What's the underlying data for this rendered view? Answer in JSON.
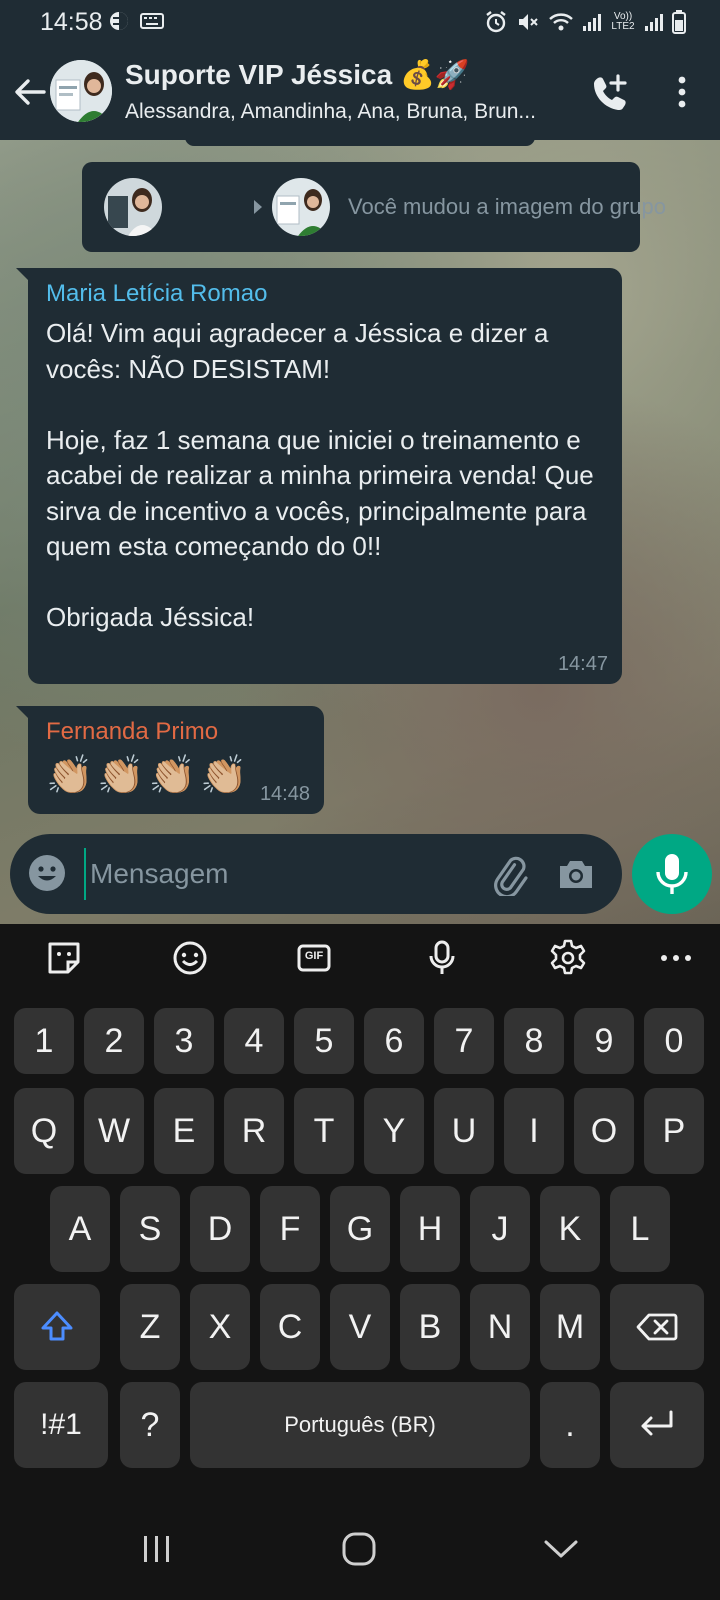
{
  "status_bar": {
    "time": "14:58",
    "left_icons": [
      "mode-icon",
      "keyboard-icon"
    ],
    "right_icons": [
      "alarm-icon",
      "mute-icon",
      "wifi-icon",
      "signal-icon",
      "volte-icon",
      "signal-icon",
      "battery-icon"
    ],
    "volte_label": "Vo)) LTE2"
  },
  "header": {
    "title": "Suporte VIP Jéssica 💰🚀",
    "subtitle": "Alessandra, Amandinha, Ana, Bruna, Brun..."
  },
  "chat": {
    "system_message": "Você mudou a imagem do grupo",
    "messages": [
      {
        "sender": "Maria Letícia Romao",
        "sender_color": "#53bdeb",
        "text": "Olá! Vim aqui agradecer a Jéssica e dizer a vocês: NÃO DESISTAM!\n\nHoje, faz 1 semana que iniciei o treinamento e acabei de realizar a minha primeira venda! Que sirva de incentivo a vocês, principalmente para quem esta começando do 0!!\n\nObrigada Jéssica!",
        "time": "14:47"
      },
      {
        "sender": "Fernanda Primo",
        "sender_color": "#e26a44",
        "emojis": [
          "👏🏼",
          "👏🏼",
          "👏🏼",
          "👏🏼"
        ],
        "time": "14:48"
      }
    ]
  },
  "composer": {
    "placeholder": "Mensagem",
    "accent": "#00a884"
  },
  "keyboard": {
    "toolbar": [
      "sticker-icon",
      "emoji-icon",
      "gif-icon",
      "voice-icon",
      "settings-icon",
      "more-icon"
    ],
    "gif_label": "GIF",
    "rows": [
      [
        "1",
        "2",
        "3",
        "4",
        "5",
        "6",
        "7",
        "8",
        "9",
        "0"
      ],
      [
        "Q",
        "W",
        "E",
        "R",
        "T",
        "Y",
        "U",
        "I",
        "O",
        "P"
      ],
      [
        "A",
        "S",
        "D",
        "F",
        "G",
        "H",
        "J",
        "K",
        "L"
      ],
      [
        "Z",
        "X",
        "C",
        "V",
        "B",
        "N",
        "M"
      ]
    ],
    "symbols_key": "!#1",
    "question_key": "?",
    "space_label": "Português (BR)",
    "period_key": "."
  },
  "nav": [
    "recents-icon",
    "home-icon",
    "back-icon"
  ]
}
